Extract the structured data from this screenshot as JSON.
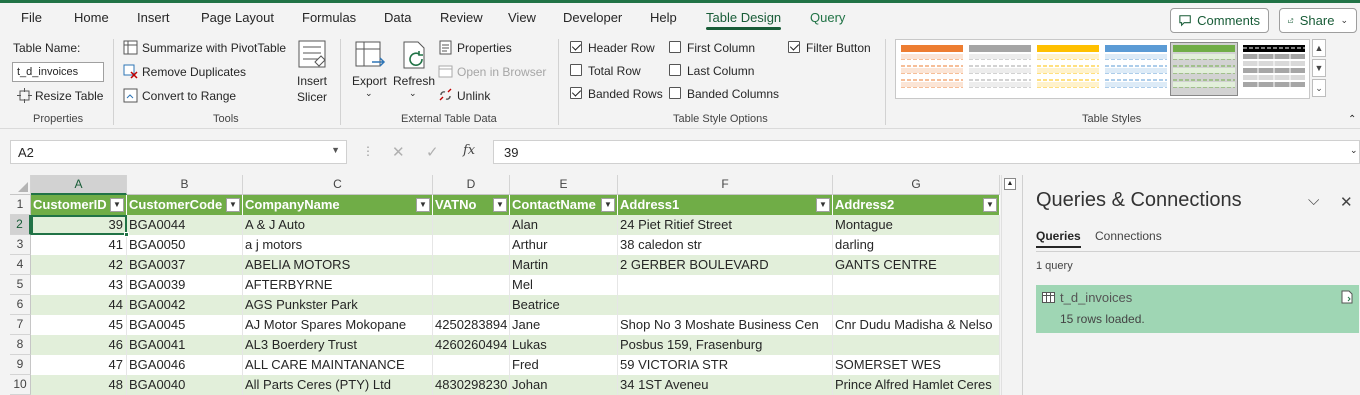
{
  "ribbon_tabs": [
    "File",
    "Home",
    "Insert",
    "Page Layout",
    "Formulas",
    "Data",
    "Review",
    "View",
    "Developer",
    "Help",
    "Table Design",
    "Query"
  ],
  "top_buttons": {
    "comments": "Comments",
    "share": "Share"
  },
  "properties": {
    "table_name_label": "Table Name:",
    "table_name_value": "t_d_invoices",
    "resize_table": "Resize Table",
    "group_label": "Properties"
  },
  "tools": {
    "summarize": "Summarize with PivotTable",
    "remove_duplicates": "Remove Duplicates",
    "convert_to_range": "Convert to Range",
    "insert_slicer_line1": "Insert",
    "insert_slicer_line2": "Slicer",
    "group_label": "Tools"
  },
  "external": {
    "export": "Export",
    "refresh": "Refresh",
    "properties": "Properties",
    "open_in_browser": "Open in Browser",
    "unlink": "Unlink",
    "group_label": "External Table Data"
  },
  "style_options": {
    "header_row": "Header Row",
    "total_row": "Total Row",
    "banded_rows": "Banded Rows",
    "first_column": "First Column",
    "last_column": "Last Column",
    "banded_columns": "Banded Columns",
    "filter_button": "Filter Button",
    "group_label": "Table Style Options"
  },
  "table_styles": {
    "group_label": "Table Styles"
  },
  "colors": {
    "accent": "#217346",
    "table_header": "#70ad47",
    "band": "#e2efda",
    "query_card": "#9fd6b4"
  },
  "formula_bar": {
    "name_box": "A2",
    "fx": "fx",
    "value": "39"
  },
  "grid": {
    "columns": [
      "A",
      "B",
      "C",
      "D",
      "E",
      "F",
      "G"
    ],
    "rows": [
      "1",
      "2",
      "3",
      "4",
      "5",
      "6",
      "7",
      "8",
      "9",
      "10"
    ],
    "headers": [
      "CustomerID",
      "CustomerCode",
      "CompanyName",
      "VATNo",
      "ContactName",
      "Address1",
      "Address2"
    ],
    "data": [
      [
        "39",
        "BGA0044",
        "A & J Auto",
        "",
        "Alan",
        "24 Piet Ritief Street",
        "Montague"
      ],
      [
        "41",
        "BGA0050",
        "a j motors",
        "",
        "Arthur",
        "38 caledon str",
        "darling"
      ],
      [
        "42",
        "BGA0037",
        "ABELIA MOTORS",
        "",
        "Martin",
        "2 GERBER BOULEVARD",
        "GANTS CENTRE"
      ],
      [
        "43",
        "BGA0039",
        "AFTERBYRNE",
        "",
        "Mel",
        "",
        ""
      ],
      [
        "44",
        "BGA0042",
        "AGS Punkster Park",
        "",
        "Beatrice",
        "",
        ""
      ],
      [
        "45",
        "BGA0045",
        "AJ Motor Spares Mokopane",
        "4250283894",
        "Jane",
        "Shop No 3 Moshate Business Cen",
        "Cnr Dudu Madisha & Nelso"
      ],
      [
        "46",
        "BGA0041",
        "AL3 Boerdery Trust",
        "4260260494",
        "Lukas",
        "Posbus 159, Frasenburg",
        ""
      ],
      [
        "47",
        "BGA0046",
        "ALL CARE MAINTANANCE",
        "",
        "Fred",
        "59 VICTORIA STR",
        "SOMERSET WES"
      ],
      [
        "48",
        "BGA0040",
        "All Parts Ceres (PTY) Ltd",
        "4830298230",
        "Johan",
        "34 1ST Aveneu",
        "Prince Alfred Hamlet Ceres"
      ]
    ]
  },
  "queries_panel": {
    "title": "Queries & Connections",
    "tabs": [
      "Queries",
      "Connections"
    ],
    "count": "1 query",
    "query_name": "t_d_invoices",
    "query_status": "15 rows loaded."
  }
}
